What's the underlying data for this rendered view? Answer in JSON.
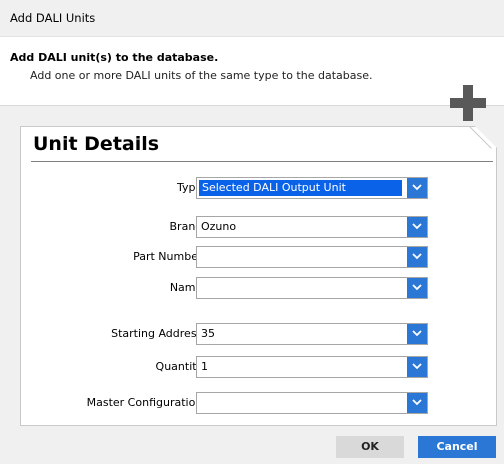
{
  "window": {
    "title": "Add DALI Units"
  },
  "header": {
    "title": "Add DALI unit(s) to the database.",
    "subtitle": "Add one or more DALI units of the same type to the database.",
    "icon": "plus-icon"
  },
  "section": {
    "title": "Unit Details"
  },
  "fields": [
    {
      "label": "Type:",
      "value": "Selected DALI Output Unit"
    },
    {
      "label": "Brand:",
      "value": "Ozuno"
    },
    {
      "label": "Part Number:",
      "value": ""
    },
    {
      "label": "Name:",
      "value": ""
    },
    {
      "label": "Starting Address:",
      "value": "35"
    },
    {
      "label": "Quantity:",
      "value": "1"
    },
    {
      "label": "Master Configuration:",
      "value": ""
    }
  ],
  "buttons": {
    "ok": "OK",
    "cancel": "Cancel"
  },
  "colors": {
    "accent": "#2a77d6",
    "selection": "#0a62e8",
    "plus_icon": "#595959"
  }
}
